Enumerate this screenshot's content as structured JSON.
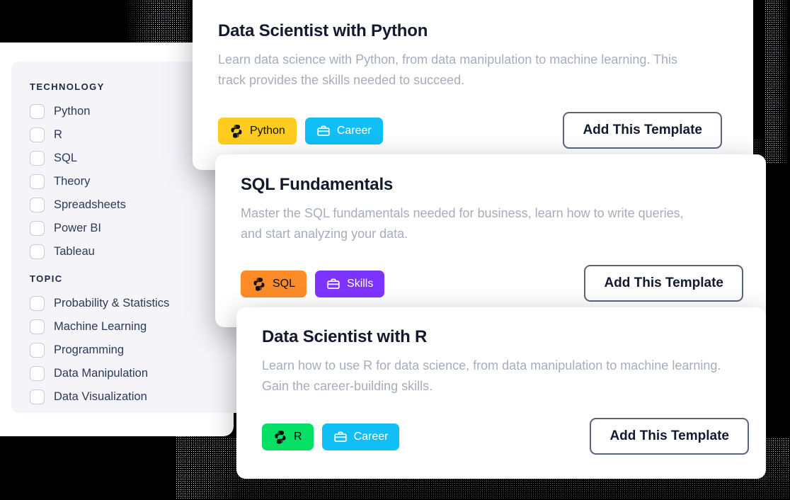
{
  "sidebar": {
    "groups": [
      {
        "heading": "TECHNOLOGY",
        "options": [
          {
            "label": "Python",
            "checked": false
          },
          {
            "label": "R",
            "checked": false
          },
          {
            "label": "SQL",
            "checked": false
          },
          {
            "label": "Theory",
            "checked": false
          },
          {
            "label": "Spreadsheets",
            "checked": false
          },
          {
            "label": "Power BI",
            "checked": false
          },
          {
            "label": "Tableau",
            "checked": false
          }
        ]
      },
      {
        "heading": "TOPIC",
        "options": [
          {
            "label": "Probability & Statistics",
            "checked": false
          },
          {
            "label": "Machine Learning",
            "checked": false
          },
          {
            "label": "Programming",
            "checked": false
          },
          {
            "label": "Data Manipulation",
            "checked": false
          },
          {
            "label": "Data Visualization",
            "checked": false
          }
        ]
      }
    ]
  },
  "cards": [
    {
      "title": "Data Scientist with Python",
      "description": "Learn data science with Python, from data manipulation to machine learning. This track provides the skills needed to succeed.",
      "button_label": "Add This Template",
      "tags": [
        {
          "label": "Python",
          "icon": "python-logo-icon",
          "bg": "#FFCD1F",
          "fg": "#111111"
        },
        {
          "label": "Career",
          "icon": "briefcase-icon",
          "bg": "#0FBFF5",
          "fg": "#FFFFFF"
        }
      ]
    },
    {
      "title": "SQL Fundamentals",
      "description": "Master the SQL fundamentals needed for business, learn how to write queries, and start analyzing your data.",
      "button_label": "Add This Template",
      "tags": [
        {
          "label": "SQL",
          "icon": "python-logo-icon",
          "bg": "#FC8B28",
          "fg": "#111111"
        },
        {
          "label": "Skills",
          "icon": "briefcase-icon",
          "bg": "#7F33FF",
          "fg": "#FFFFFF"
        }
      ]
    },
    {
      "title": "Data Scientist with R",
      "description": "Learn how to use R for data science, from data manipulation to machine learning. Gain the career-building skills.",
      "button_label": "Add This Template",
      "tags": [
        {
          "label": "R",
          "icon": "python-logo-icon",
          "bg": "#05E065",
          "fg": "#111111"
        },
        {
          "label": "Career",
          "icon": "briefcase-icon",
          "bg": "#0FBFF5",
          "fg": "#FFFFFF"
        }
      ]
    }
  ],
  "colors": {
    "background": "#000000",
    "card_surface": "#FFFFFF",
    "filter_panel": "#F4F4F9",
    "title_text": "#131A2B",
    "body_text": "#A6ADBB",
    "checkbox_border": "#C6CBD8",
    "button_border": "#5B6579"
  }
}
